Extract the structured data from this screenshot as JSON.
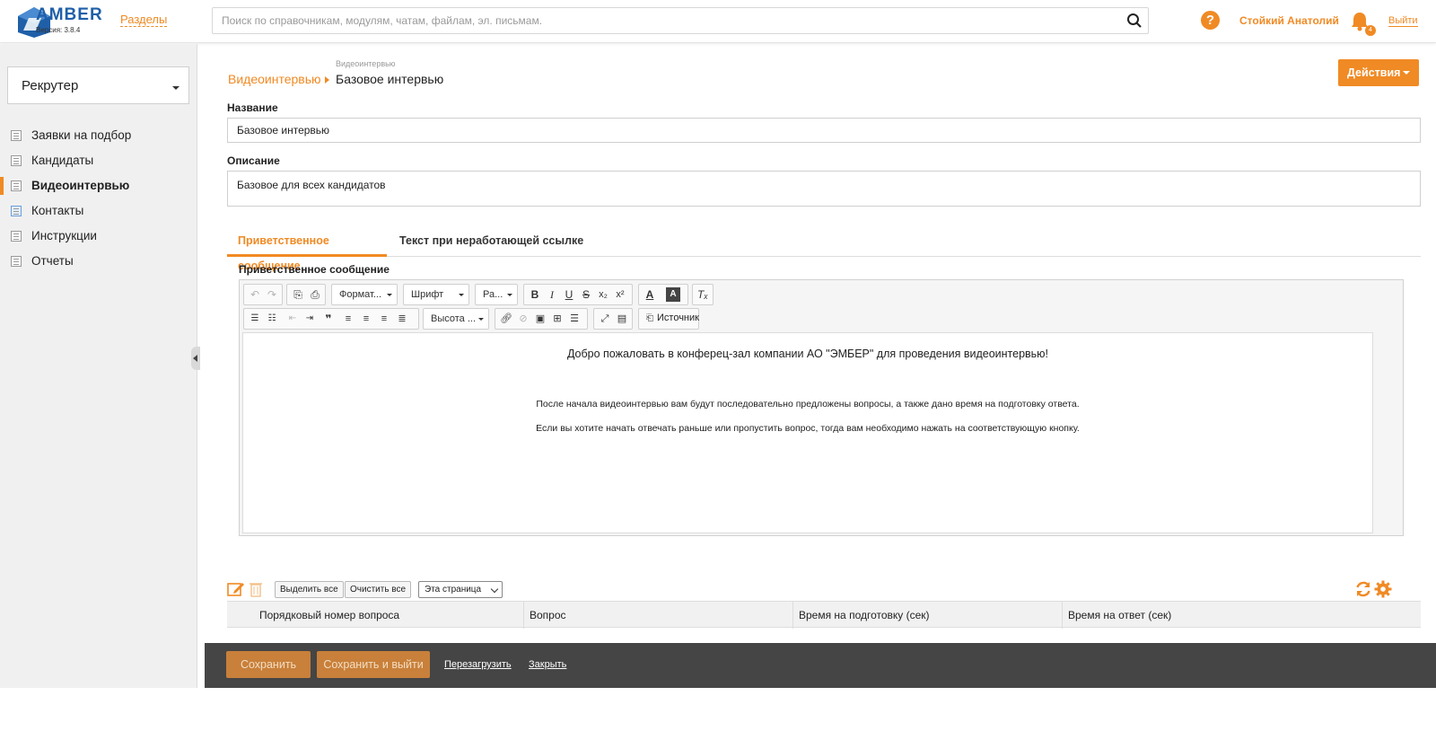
{
  "header": {
    "logo_text": "AMBER",
    "version": "Версия: 3.8.4",
    "sections_link": "Разделы",
    "search_placeholder": "Поиск по справочникам, модулям, чатам, файлам, эл. письмам.",
    "user_name": "Стойкий Анатолий",
    "notification_count": "4",
    "logout": "Выйти"
  },
  "sidebar": {
    "role": "Рекрутер",
    "items": [
      {
        "label": "Заявки на подбор",
        "active": false,
        "icon": "document-icon"
      },
      {
        "label": "Кандидаты",
        "active": false,
        "icon": "document-icon"
      },
      {
        "label": "Видеоинтервью",
        "active": true,
        "icon": "document-icon"
      },
      {
        "label": "Контакты",
        "active": false,
        "icon": "contacts-book-icon"
      },
      {
        "label": "Инструкции",
        "active": false,
        "icon": "document-icon"
      },
      {
        "label": "Отчеты",
        "active": false,
        "icon": "document-icon"
      }
    ]
  },
  "breadcrumb": {
    "small": "Видеоинтервью",
    "parent": "Видеоинтервью",
    "current": "Базовое интервью"
  },
  "actions_label": "Действия",
  "form": {
    "name_label": "Название",
    "name_value": "Базовое интервью",
    "description_label": "Описание",
    "description_value": "Базовое для всех кандидатов"
  },
  "tabs": {
    "welcome": "Приветственное сообщение",
    "broken_link": "Текст при неработающей ссылке"
  },
  "editor": {
    "label": "Приветственное сообщение",
    "format_combo": "Формат...",
    "font_combo": "Шрифт",
    "size_combo": "Ра...",
    "height_combo": "Высота ...",
    "source_label": "Источник",
    "line1": "Добро пожаловать в конферец-зал компании АО \"ЭМБЕР\" для проведения видеоинтервью!",
    "line2": "После начала видеоинтервью вам будут последовательно предложены вопросы, а также дано время на подготовку ответа.",
    "line3": "Если вы хотите начать отвечать раньше или пропустить вопрос, тогда вам необходимо нажать на соответствующую кнопку."
  },
  "grid": {
    "select_all": "Выделить все",
    "clear_all": "Очистить все",
    "scope": "Эта страница",
    "columns": [
      "Порядковый номер вопроса",
      "Вопрос",
      "Время на подготовку (сек)",
      "Время на ответ (сек)"
    ]
  },
  "footer": {
    "save": "Сохранить",
    "save_exit": "Сохранить и выйти",
    "reload": "Перезагрузить",
    "close": "Закрыть"
  },
  "colors": {
    "accent": "#f08a24",
    "brand_blue": "#1f5fa8",
    "footer_bg": "#454545",
    "footer_button": "#c8803a"
  }
}
